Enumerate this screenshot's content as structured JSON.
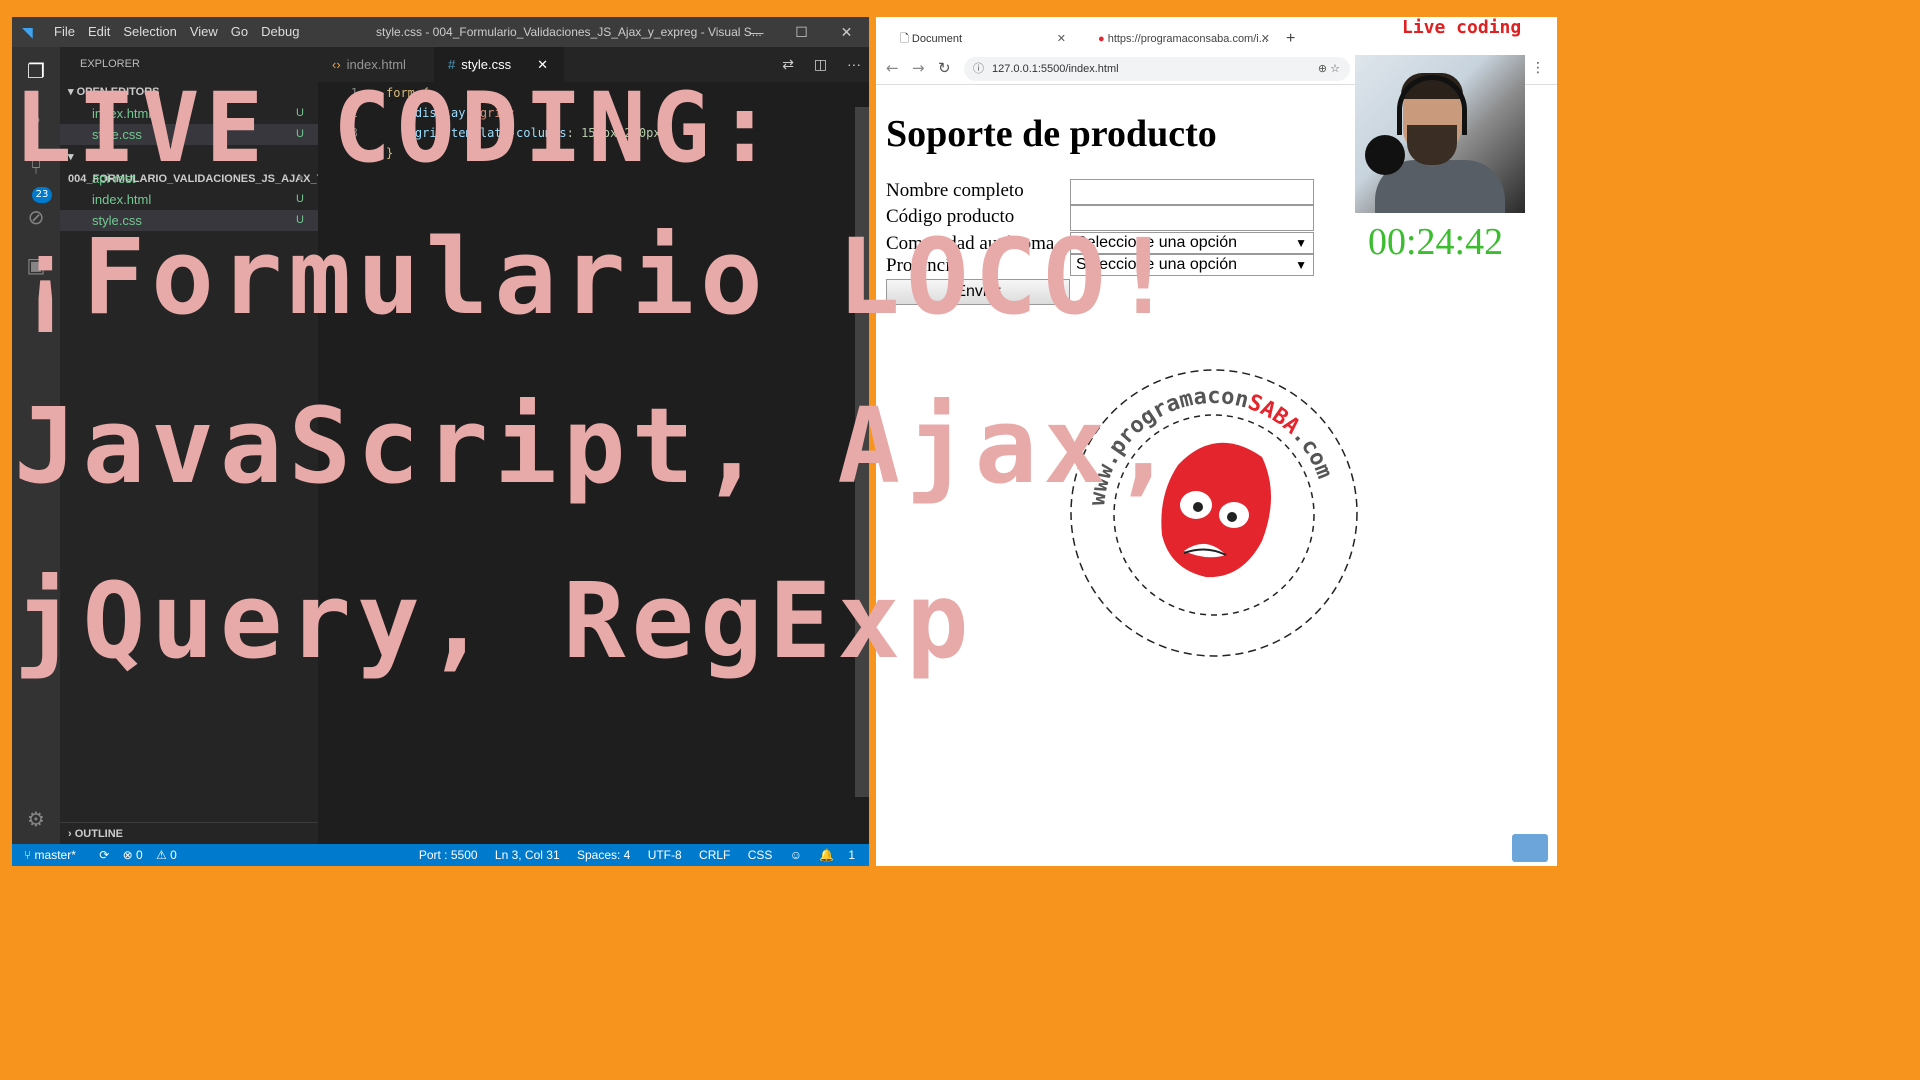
{
  "vscode": {
    "menu": [
      "File",
      "Edit",
      "Selection",
      "View",
      "Go",
      "Debug"
    ],
    "title": "style.css - 004_Formulario_Validaciones_JS_Ajax_y_expreg - Visual S...",
    "explorer_label": "EXPLORER",
    "open_editors_label": "OPEN EDITORS",
    "open_editors": [
      {
        "name": "index.html",
        "status": "U"
      },
      {
        "name": "style.css",
        "status": "U"
      }
    ],
    "folder_label": "004_FORMULARIO_VALIDACIONES_JS_AJAX_Y_...",
    "files": [
      {
        "name": "api-rest",
        "status": "●"
      },
      {
        "name": "index.html",
        "status": "U"
      },
      {
        "name": "style.css",
        "status": "U"
      }
    ],
    "scm_badge": "23",
    "outline_label": "OUTLINE",
    "tabs": [
      {
        "label": "index.html",
        "icon": "html-icon"
      },
      {
        "label": "style.css",
        "icon": "css-icon"
      }
    ],
    "code_lines": [
      {
        "num": "1",
        "selector": "form {",
        "prop": "",
        "val": ""
      },
      {
        "num": "2",
        "selector": "",
        "prop": "    display",
        "val": ": grid;"
      },
      {
        "num": "3",
        "selector": "",
        "prop": "    grid-template-columns",
        "val": ": 150px 200px;"
      },
      {
        "num": "4",
        "selector": "}",
        "prop": "",
        "val": ""
      }
    ],
    "status": {
      "branch": "master*",
      "sync": "⟳",
      "errors": "0",
      "warnings": "0",
      "port": "Port : 5500",
      "position": "Ln 3, Col 31",
      "spaces": "Spaces: 4",
      "encoding": "UTF-8",
      "eol": "CRLF",
      "language": "CSS",
      "notifications": "1"
    }
  },
  "overlay": {
    "line1": "LIVE CODING:",
    "line2": "¡Formulario LOCO!",
    "line3": "JavaScript, Ajax,",
    "line4": "jQuery, RegExp",
    "color": "#e8aaa8"
  },
  "browser": {
    "tabs": [
      {
        "label": "Document"
      },
      {
        "label": "https://programaconsaba.com/i..."
      }
    ],
    "url": "127.0.0.1:5500/index.html",
    "live_label": "Live coding",
    "page": {
      "heading": "Soporte de producto",
      "fields": [
        {
          "label": "Nombre completo",
          "type": "text",
          "value": ""
        },
        {
          "label": "Código producto",
          "type": "text",
          "value": ""
        },
        {
          "label": "Comunidad autónoma",
          "type": "select",
          "value": "Seleccione una opción"
        },
        {
          "label": "Provincia",
          "type": "select",
          "value": "Seleccione una opción"
        }
      ],
      "submit": "Enviar"
    },
    "timer": "00:24:42",
    "logo": {
      "text_top": "www.programacon",
      "text_brand": "SABA",
      "text_tld": ".com",
      "brand_color": "#e4252d"
    }
  }
}
